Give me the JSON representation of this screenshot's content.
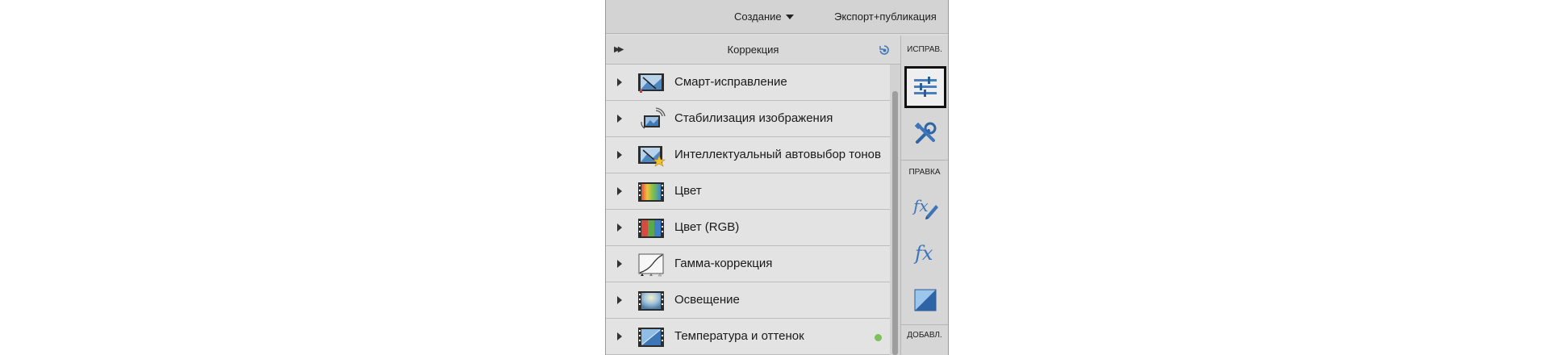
{
  "topbar": {
    "create_label": "Создание",
    "export_label": "Экспорт+публикация"
  },
  "panel": {
    "title": "Коррекция"
  },
  "items": [
    {
      "label": "Смарт-исправление",
      "icon": "smart-fix-icon"
    },
    {
      "label": "Стабилизация изображения",
      "icon": "image-stabilization-icon"
    },
    {
      "label": "Интеллектуальный автовыбор тонов",
      "icon": "smart-tone-icon"
    },
    {
      "label": "Цвет",
      "icon": "color-icon"
    },
    {
      "label": "Цвет (RGB)",
      "icon": "color-rgb-icon"
    },
    {
      "label": "Гамма-коррекция",
      "icon": "gamma-curve-icon"
    },
    {
      "label": "Освещение",
      "icon": "lighting-icon"
    },
    {
      "label": "Температура и оттенок",
      "icon": "temperature-tint-icon",
      "indicator_color": "#7dc15a"
    }
  ],
  "sidebar": {
    "fix_label": "ИСПРАВ.",
    "edit_label": "ПРАВКА",
    "add_label": "ДОБАВЛ.",
    "buttons": [
      {
        "icon": "adjustments-sliders-icon",
        "active": true
      },
      {
        "icon": "tools-icon",
        "active": false
      },
      {
        "icon": "fx-edit-icon",
        "active": false
      },
      {
        "icon": "fx-icon",
        "active": false
      },
      {
        "icon": "gradient-square-icon",
        "active": false
      }
    ]
  },
  "colors": {
    "accent_blue": "#3f76b8",
    "indicator_green": "#7dc15a"
  }
}
